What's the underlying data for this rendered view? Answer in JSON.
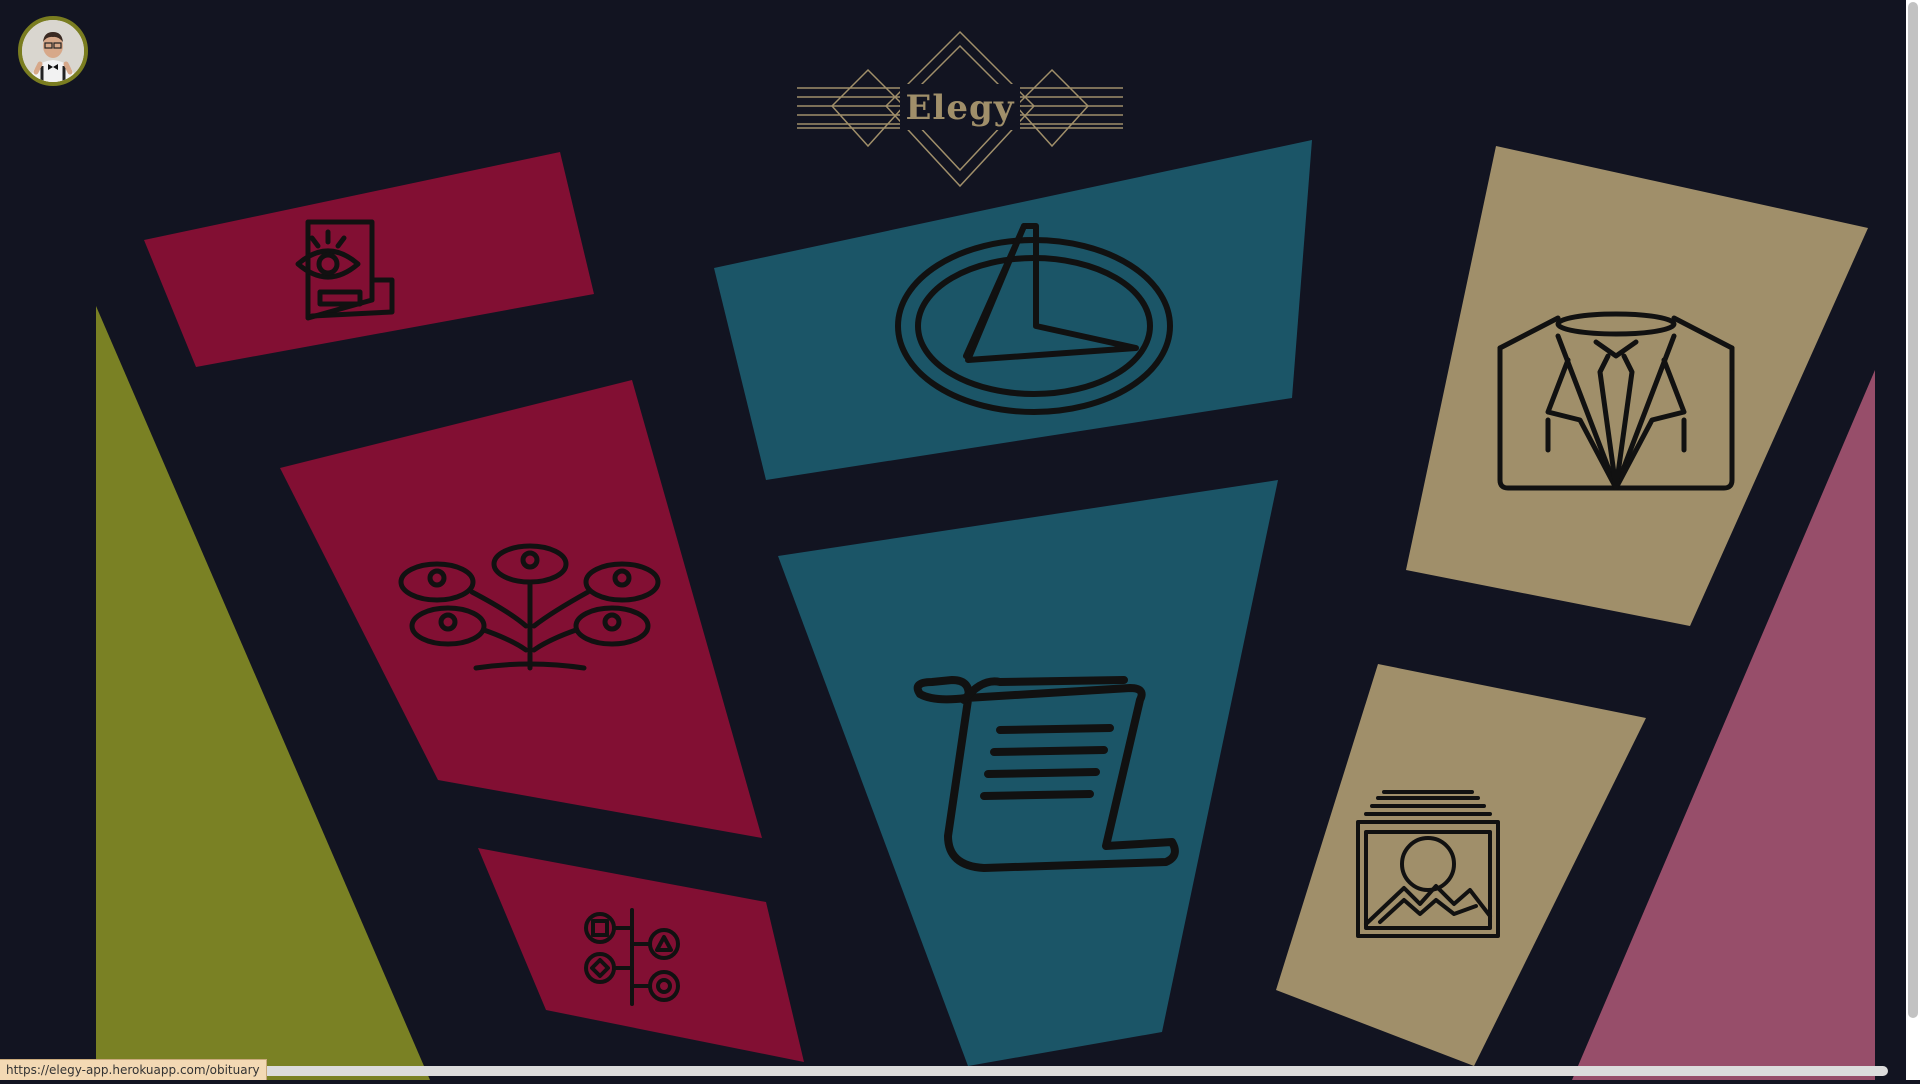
{
  "app": {
    "title": "Elegy",
    "status_url": "https://elegy-app.herokuapp.com/obituary"
  },
  "user": {
    "avatar": "user-avatar"
  },
  "colors": {
    "background": "#121421",
    "crimson": "#820f33",
    "teal": "#1b5567",
    "khaki": "#a08f6a",
    "olive": "#7a8124",
    "rose": "#974e6a",
    "gold_line": "#a08f6a",
    "icon": "#111111"
  },
  "tiles": [
    {
      "id": "tile-eye-document",
      "icon": "eye-document-icon",
      "color": "crimson"
    },
    {
      "id": "tile-family-tree",
      "icon": "family-tree-icon",
      "color": "crimson"
    },
    {
      "id": "tile-timeline",
      "icon": "shapes-timeline-icon",
      "color": "crimson"
    },
    {
      "id": "tile-sundial",
      "icon": "sundial-icon",
      "color": "teal"
    },
    {
      "id": "tile-scroll",
      "icon": "scroll-icon",
      "color": "teal"
    },
    {
      "id": "tile-suit",
      "icon": "suit-icon",
      "color": "khaki"
    },
    {
      "id": "tile-photos",
      "icon": "photo-gallery-icon",
      "color": "khaki"
    }
  ]
}
